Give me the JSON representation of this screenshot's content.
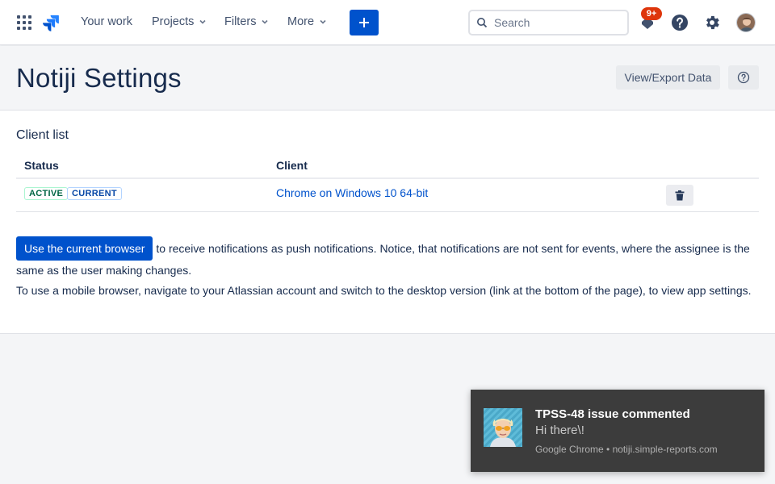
{
  "nav": {
    "your_work": "Your work",
    "projects": "Projects",
    "filters": "Filters",
    "more": "More",
    "search_placeholder": "Search",
    "notifications_badge": "9+"
  },
  "header": {
    "title": "Notiji Settings",
    "export_label": "View/Export Data"
  },
  "client_list": {
    "title": "Client list",
    "columns": [
      "Status",
      "Client"
    ],
    "rows": [
      {
        "status_tags": [
          "ACTIVE",
          "CURRENT"
        ],
        "client": "Chrome on Windows 10 64-bit"
      }
    ]
  },
  "info": {
    "use_browser_button": "Use the current browser",
    "push_text": "to receive notifications as push notifications. Notice, that notifications are not sent for events, where the assignee is the same as the user making changes.",
    "mobile_text": "To use a mobile browser, navigate to your Atlassian account and switch to the desktop version (link at the bottom of the page), to view app settings."
  },
  "toast": {
    "title": "TPSS-48 issue commented",
    "body": "Hi there\\!",
    "source": "Google Chrome • notiji.simple-reports.com"
  },
  "colors": {
    "brand_blue": "#0052cc",
    "badge_red": "#de350b",
    "toast_bg": "#3c3c3c"
  }
}
